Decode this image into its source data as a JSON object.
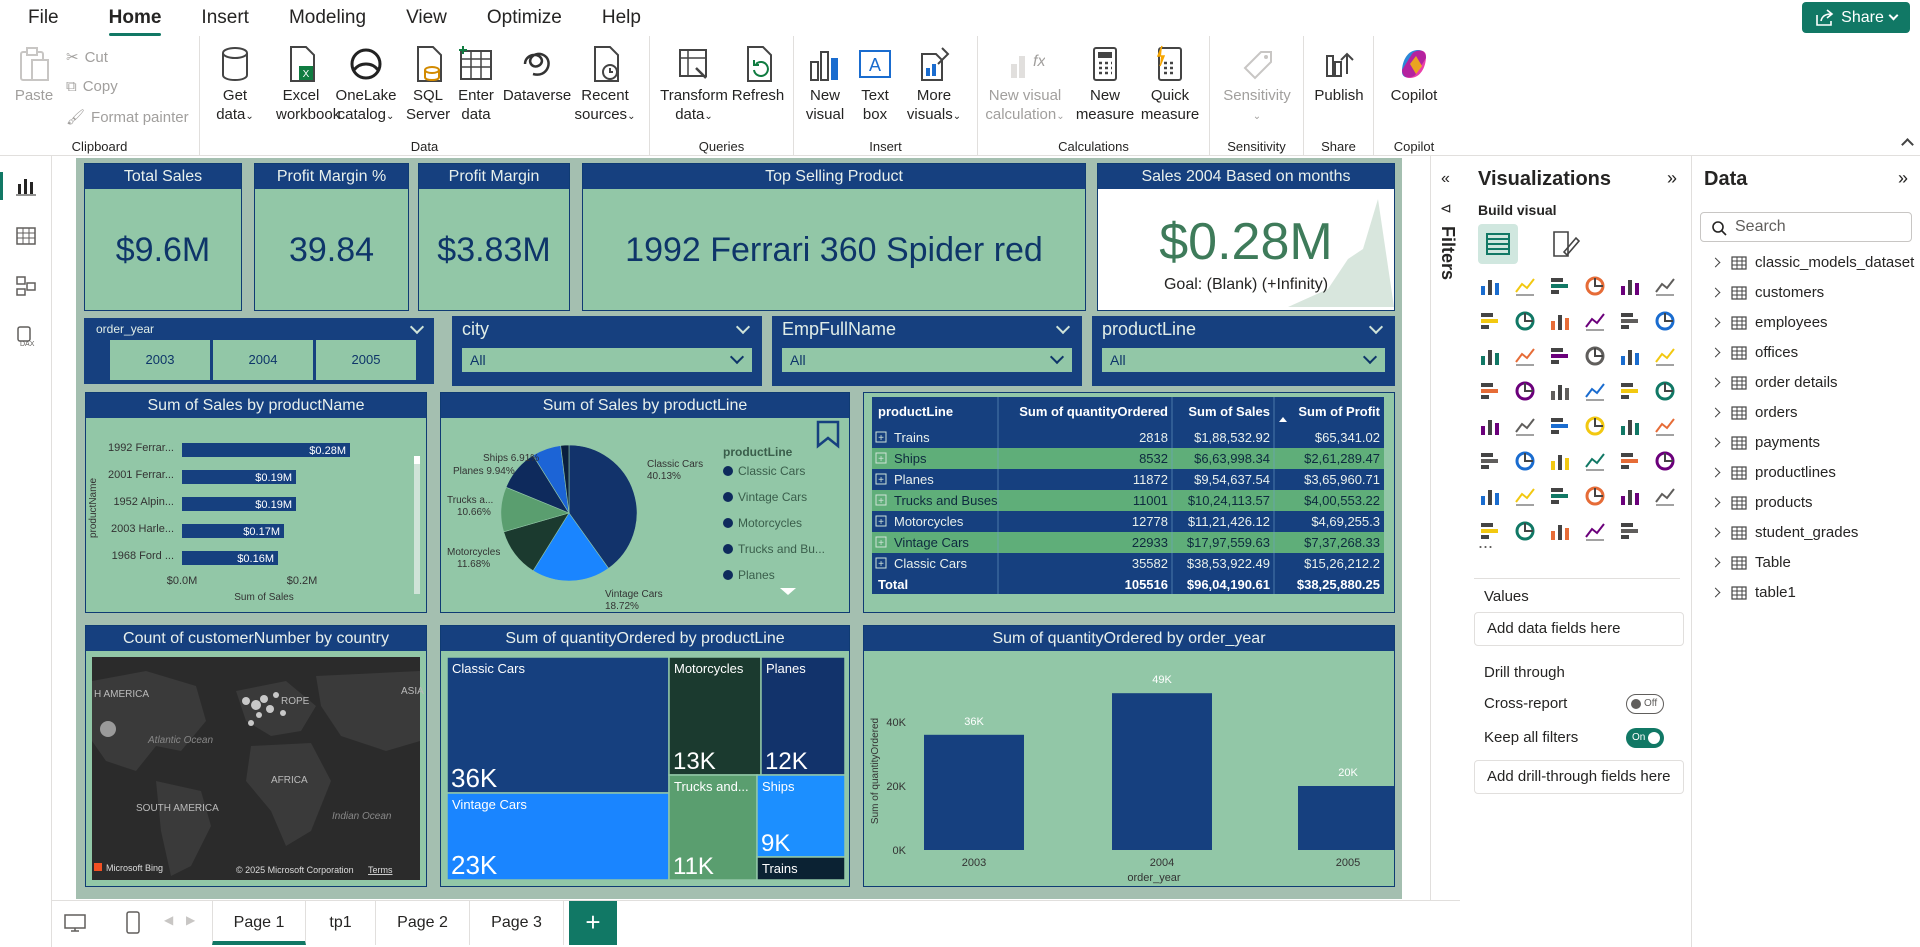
{
  "menu": {
    "items": [
      "File",
      "Home",
      "Insert",
      "Modeling",
      "View",
      "Optimize",
      "Help"
    ],
    "share": "Share"
  },
  "ribbon": {
    "clipboard": {
      "paste": "Paste",
      "cut": "Cut",
      "copy": "Copy",
      "format_painter": "Format painter",
      "label": "Clipboard"
    },
    "data": {
      "get_data": [
        "Get",
        "data"
      ],
      "excel": [
        "Excel",
        "workbook"
      ],
      "onelake": [
        "OneLake",
        "catalog"
      ],
      "sql": [
        "SQL",
        "Server"
      ],
      "enter": [
        "Enter",
        "data"
      ],
      "dataverse": "Dataverse",
      "recent": [
        "Recent",
        "sources"
      ],
      "label": "Data"
    },
    "queries": {
      "transform": [
        "Transform",
        "data"
      ],
      "refresh": "Refresh",
      "label": "Queries"
    },
    "insert": {
      "new_visual": [
        "New",
        "visual"
      ],
      "text_box": [
        "Text",
        "box"
      ],
      "more_visuals": [
        "More",
        "visuals"
      ],
      "label": "Insert"
    },
    "calculations": {
      "new_visual_calc": [
        "New visual",
        "calculation"
      ],
      "new_measure": [
        "New",
        "measure"
      ],
      "quick_measure": [
        "Quick",
        "measure"
      ],
      "label": "Calculations"
    },
    "sensitivity": {
      "btn": "Sensitivity",
      "label": "Sensitivity"
    },
    "share": {
      "publish": "Publish",
      "label": "Share"
    },
    "copilot": {
      "btn": "Copilot",
      "label": "Copilot"
    }
  },
  "kpis": {
    "total_sales": {
      "title": "Total Sales",
      "value": "$9.6M"
    },
    "profit_margin_pct": {
      "title": "Profit Margin %",
      "value": "39.84"
    },
    "profit_margin": {
      "title": "Profit Margin",
      "value": "$3.83M"
    },
    "top_product": {
      "title": "Top Selling Product",
      "value": "1992 Ferrari 360 Spider red"
    },
    "sales_2004": {
      "title": "Sales 2004 Based on months",
      "value": "$0.28M",
      "goal": "Goal: (Blank) (+Infinity)"
    }
  },
  "slicers": {
    "order_year": {
      "title": "order_year",
      "options": [
        "2003",
        "2004",
        "2005"
      ]
    },
    "city": {
      "title": "city",
      "value": "All"
    },
    "emp": {
      "title": "EmpFullName",
      "value": "All"
    },
    "productline": {
      "title": "productLine",
      "value": "All"
    }
  },
  "bar_chart": {
    "title": "Sum of Sales by productName",
    "ylabel": "productName",
    "xlabel": "Sum of Sales",
    "ticks": [
      "$0.0M",
      "$0.2M"
    ],
    "chart_data": {
      "type": "bar",
      "categories": [
        "1992 Ferrar...",
        "2001 Ferrar...",
        "1952 Alpin...",
        "2003 Harle...",
        "1968 Ford ..."
      ],
      "values": [
        0.28,
        0.19,
        0.19,
        0.17,
        0.16
      ],
      "labels": [
        "$0.28M",
        "$0.19M",
        "$0.19M",
        "$0.17M",
        "$0.16M"
      ],
      "xlabel": "Sum of Sales",
      "ylabel": "productName"
    }
  },
  "pie_chart": {
    "title": "Sum of Sales by productLine",
    "legend_title": "productLine",
    "chart_data": {
      "type": "pie",
      "categories": [
        "Classic Cars",
        "Vintage Cars",
        "Motorcycles",
        "Trucks and Buses",
        "Planes",
        "Ships",
        "Trains"
      ],
      "values": [
        40.13,
        18.72,
        11.68,
        10.66,
        9.94,
        6.91,
        1.96
      ],
      "legend": [
        "Classic Cars",
        "Vintage Cars",
        "Motorcycles",
        "Trucks and Bu...",
        "Planes"
      ],
      "colors": [
        "#12336b",
        "#1a85ff",
        "#1b3a2f",
        "#5a9e6f",
        "#0e2a5c",
        "#1c64d6",
        "#0a1f3d"
      ]
    },
    "labels": {
      "classic": [
        "Classic Cars",
        "40.13%"
      ],
      "vintage": [
        "Vintage Cars",
        "18.72%"
      ],
      "moto": [
        "Motorcycles",
        "11.68%"
      ],
      "trucks": [
        "Trucks a...",
        "10.66%"
      ],
      "planes": "Planes 9.94%",
      "ships": "Ships 6.91%"
    }
  },
  "table": {
    "headers": [
      "productLine",
      "Sum of quantityOrdered",
      "Sum of Sales",
      "Sum of Profit"
    ],
    "rows": [
      [
        "Trains",
        "2818",
        "$1,88,532.92",
        "$65,341.02"
      ],
      [
        "Ships",
        "8532",
        "$6,63,998.34",
        "$2,61,289.47"
      ],
      [
        "Planes",
        "11872",
        "$9,54,637.54",
        "$3,65,960.71"
      ],
      [
        "Trucks and Buses",
        "11001",
        "$10,24,113.57",
        "$4,00,553.22"
      ],
      [
        "Motorcycles",
        "12778",
        "$11,21,426.12",
        "$4,69,255.3"
      ],
      [
        "Vintage Cars",
        "22933",
        "$17,97,559.63",
        "$7,37,268.33"
      ],
      [
        "Classic Cars",
        "35582",
        "$38,53,922.49",
        "$15,26,212.2"
      ]
    ],
    "total": [
      "Total",
      "105516",
      "$96,04,190.61",
      "$38,25,880.25"
    ]
  },
  "map": {
    "title": "Count of customerNumber by country",
    "labels": [
      "H AMERICA",
      "ROPE",
      "ASIA",
      "Atlantic Ocean",
      "AFRICA",
      "SOUTH AMERICA",
      "Indian Ocean"
    ],
    "bing": "Microsoft Bing",
    "copyright": "© 2025 Microsoft Corporation",
    "terms": "Terms"
  },
  "treemap": {
    "title": "Sum of quantityOrdered by productLine",
    "chart_data": {
      "type": "treemap",
      "categories": [
        "Classic Cars",
        "Vintage Cars",
        "Motorcycles",
        "Trucks and...",
        "Planes",
        "Ships",
        "Trains"
      ],
      "values": [
        36,
        23,
        13,
        11,
        12,
        9,
        3
      ],
      "labels": [
        "36K",
        "23K",
        "13K",
        "11K",
        "12K",
        "9K",
        ""
      ]
    }
  },
  "column_chart": {
    "title": "Sum of quantityOrdered by order_year",
    "ylabel": "Sum of quantityOrdered",
    "xlabel": "order_year",
    "yticks": [
      "0K",
      "20K",
      "40K"
    ],
    "chart_data": {
      "type": "bar",
      "categories": [
        "2003",
        "2004",
        "2005"
      ],
      "values": [
        36,
        49,
        20
      ],
      "labels": [
        "36K",
        "49K",
        "20K"
      ],
      "ylim": [
        0,
        50
      ]
    }
  },
  "filters": {
    "label": "Filters"
  },
  "viz_pane": {
    "title": "Visualizations",
    "build": "Build visual",
    "values": "Values",
    "add_fields": "Add data fields here",
    "drill": "Drill through",
    "cross": "Cross-report",
    "cross_state": "Off",
    "keep": "Keep all filters",
    "keep_state": "On",
    "add_drill": "Add drill-through fields here",
    "more": "..."
  },
  "data_pane": {
    "title": "Data",
    "search": "Search",
    "items": [
      "classic_models_dataset",
      "customers",
      "employees",
      "offices",
      "order details",
      "orders",
      "payments",
      "productlines",
      "products",
      "student_grades",
      "Table",
      "table1"
    ]
  },
  "tabs": [
    "Page 1",
    "tp1",
    "Page 2",
    "Page 3"
  ]
}
